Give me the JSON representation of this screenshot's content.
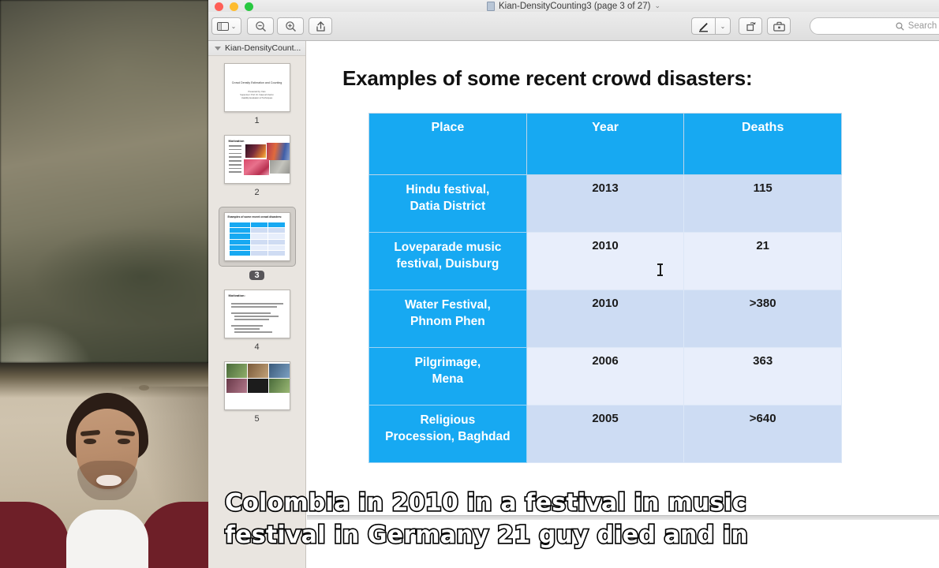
{
  "window": {
    "title": "Kian-DensityCounting3 (page 3 of 27)",
    "title_chevron": "⌄",
    "doc_icon": "document-icon",
    "traffic_lights": [
      "close",
      "minimize",
      "zoom"
    ]
  },
  "toolbar": {
    "sidebar_button": "sidebar-toggle-icon",
    "sidebar_menu_chevron": "⌄",
    "zoom_out_button": "zoom-out-icon",
    "zoom_in_button": "zoom-in-icon",
    "share_button": "share-icon",
    "markup_button": "markup-pen-icon",
    "markup_menu_chevron": "⌄",
    "rotate_button": "rotate-icon",
    "toolbox_button": "toolbox-icon",
    "search": {
      "placeholder": "Search",
      "value": "",
      "icon": "search-icon"
    }
  },
  "sidebar": {
    "header_label": "Kian-DensityCount...",
    "disclosure": "disclosure-triangle-icon",
    "thumbnails": [
      {
        "number": "1",
        "selected": false,
        "kind": "title-slide",
        "title": "Crowd Density Estimation and Counting",
        "subtitle": "Presented by: Kian\nSupervisor: Prof. Dr. Fatemeh Karimi\nUsability Evaluation of Techniques of Performance"
      },
      {
        "number": "2",
        "selected": false,
        "kind": "images-slide",
        "heading": "Motivation"
      },
      {
        "number": "3",
        "selected": true,
        "kind": "table-slide",
        "heading": "Examples of some recent crowd disasters:"
      },
      {
        "number": "4",
        "selected": false,
        "kind": "bullets-slide",
        "heading": "Motivation:"
      },
      {
        "number": "5",
        "selected": false,
        "kind": "images-slide",
        "heading": ""
      }
    ]
  },
  "slide": {
    "title": "Examples of some recent crowd disasters:",
    "table": {
      "headers": [
        "Place",
        "Year",
        "Deaths"
      ],
      "rows": [
        {
          "place": "Hindu festival,\nDatia District",
          "year": "2013",
          "deaths": "115"
        },
        {
          "place": "Loveparade music\nfestival, Duisburg",
          "year": "2010",
          "deaths": "21"
        },
        {
          "place": "Water Festival,\nPhnom Phen",
          "year": "2010",
          "deaths": ">380"
        },
        {
          "place": "Pilgrimage,\nMena",
          "year": "2006",
          "deaths": "363"
        },
        {
          "place": "Religious\nProcession, Baghdad",
          "year": "2005",
          "deaths": ">640"
        }
      ]
    }
  },
  "caption": {
    "line1": "Colombia in 2010 in a festival in music",
    "line2": "festival in Germany 21 guy died and in"
  },
  "colors": {
    "table_header_blue": "#17a9f2",
    "row_alt_dark": "#cddcf3",
    "row_alt_light": "#e8eefb",
    "selection_gray": "#58565a",
    "sidebar_bg": "#e9e5e0"
  }
}
